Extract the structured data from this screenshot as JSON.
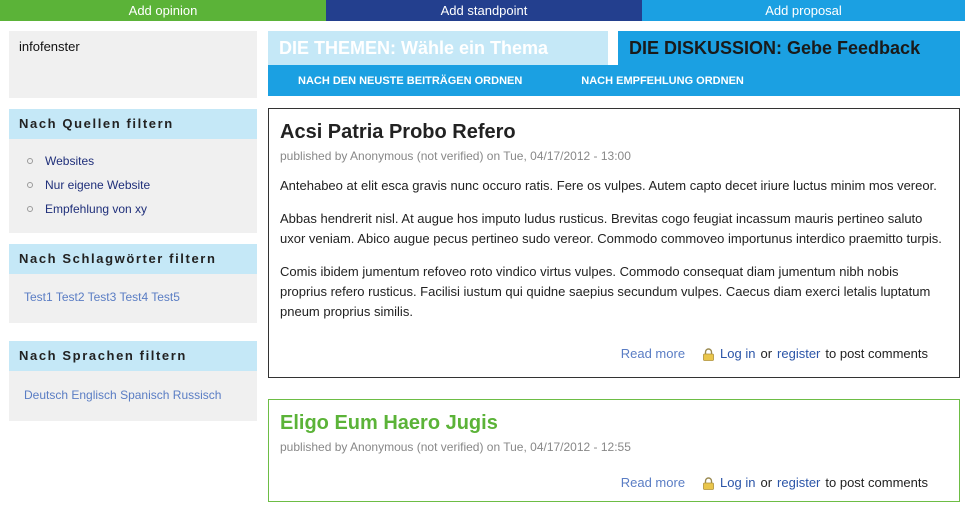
{
  "topbar": {
    "add_opinion": "Add opinion",
    "add_standpoint": "Add standpoint",
    "add_proposal": "Add proposal"
  },
  "colors": {
    "opinion": "#5bb338",
    "standpoint": "#233f8e",
    "proposal": "#1ba0e2",
    "sidebar_header": "#c5e8f7"
  },
  "sidebar": {
    "infobox": "infofenster",
    "sources": {
      "title": "Nach Quellen filtern",
      "items": [
        "Websites",
        "Nur eigene Website",
        "Empfehlung von xy"
      ]
    },
    "tags": {
      "title": "Nach Schlagwörter filtern",
      "items": [
        "Test1",
        "Test2",
        "Test3",
        "Test4",
        "Test5"
      ]
    },
    "languages": {
      "title": "Nach Sprachen filtern",
      "items": [
        "Deutsch",
        "Englisch",
        "Spanisch",
        "Russisch"
      ]
    }
  },
  "main": {
    "tab_themen": "DIE THEMEN: Wähle ein Thema",
    "tab_diskussion": "DIE DISKUSSION: Gebe Feedback",
    "sort_newest": "NACH DEN NEUSTE BEITRÄGEN ORDNEN",
    "sort_recommendation": "NACH EMPFEHLUNG ORDNEN",
    "posts": [
      {
        "title": "Acsi Patria Probo Refero",
        "meta": "published by Anonymous (not verified) on Tue, 04/17/2012 - 13:00",
        "paragraphs": [
          "Antehabeo at elit esca gravis nunc occuro ratis. Fere os vulpes. Autem capto decet iriure luctus minim mos vereor.",
          "Abbas hendrerit nisl. At augue hos imputo ludus rusticus. Brevitas cogo feugiat incassum mauris pertineo saluto uxor veniam. Abico augue pecus pertineo sudo vereor. Commodo commoveo importunus interdico praemitto turpis.",
          "Comis ibidem jumentum refoveo roto vindico virtus vulpes. Commodo consequat diam jumentum nibh nobis proprius refero rusticus. Facilisi iustum qui quidne saepius secundum vulpes. Caecus diam exerci letalis luptatum pneum proprius similis."
        ],
        "read_more": "Read more",
        "log_in": "Log in",
        "or": "or",
        "register": "register",
        "to_post": "to post comments"
      },
      {
        "title": "Eligo Eum Haero Jugis",
        "meta": "published by Anonymous (not verified) on Tue, 04/17/2012 - 12:55",
        "read_more": "Read more",
        "log_in": "Log in",
        "or": "or",
        "register": "register",
        "to_post": "to post comments"
      }
    ]
  }
}
